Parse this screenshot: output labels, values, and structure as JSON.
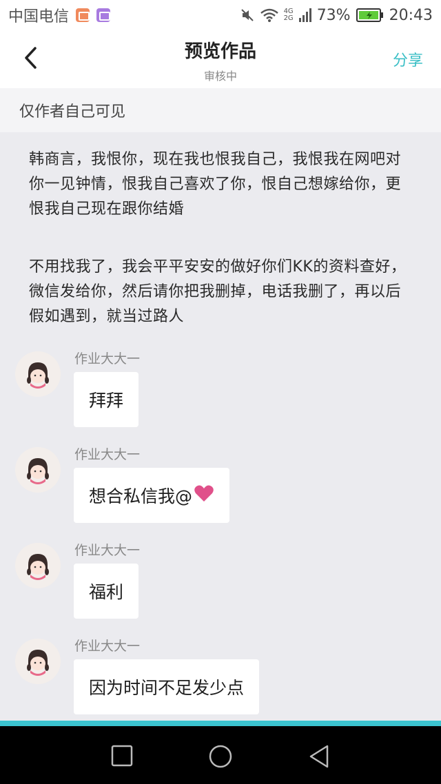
{
  "status_bar": {
    "carrier": "中国电信",
    "network_top": "4G",
    "network_bottom": "2G",
    "battery_percent": "73%",
    "time": "20:43",
    "icons": [
      "mail-icon",
      "gallery-icon",
      "mute-icon",
      "wifi-icon",
      "signal-icon",
      "battery-icon"
    ]
  },
  "header": {
    "title": "预览作品",
    "subtitle": "审核中",
    "share_label": "分享",
    "accent_color": "#3bbfc6"
  },
  "visibility_notice": "仅作者自己可见",
  "paragraphs": [
    "韩商言，我恨你，现在我也恨我自己，我恨我在网吧对你一见钟情，恨我自己喜欢了你，恨自己想嫁给你，更恨我自己现在跟你结婚",
    "不用找我了，我会平平安安的做好你们KK的资料查好，微信发给你，然后请你把我删掉，电话我删了，再以后假如遇到，就当过路人"
  ],
  "messages": [
    {
      "sender": "作业大大一",
      "text": "拜拜"
    },
    {
      "sender": "作业大大一",
      "text": "想合私信我@"
    },
    {
      "sender": "作业大大一",
      "text": "福利"
    },
    {
      "sender": "作业大大一",
      "text": "因为时间不足发少点"
    }
  ],
  "nav_bar": {
    "buttons": [
      "recent-apps-icon",
      "home-icon",
      "back-triangle-icon"
    ]
  }
}
